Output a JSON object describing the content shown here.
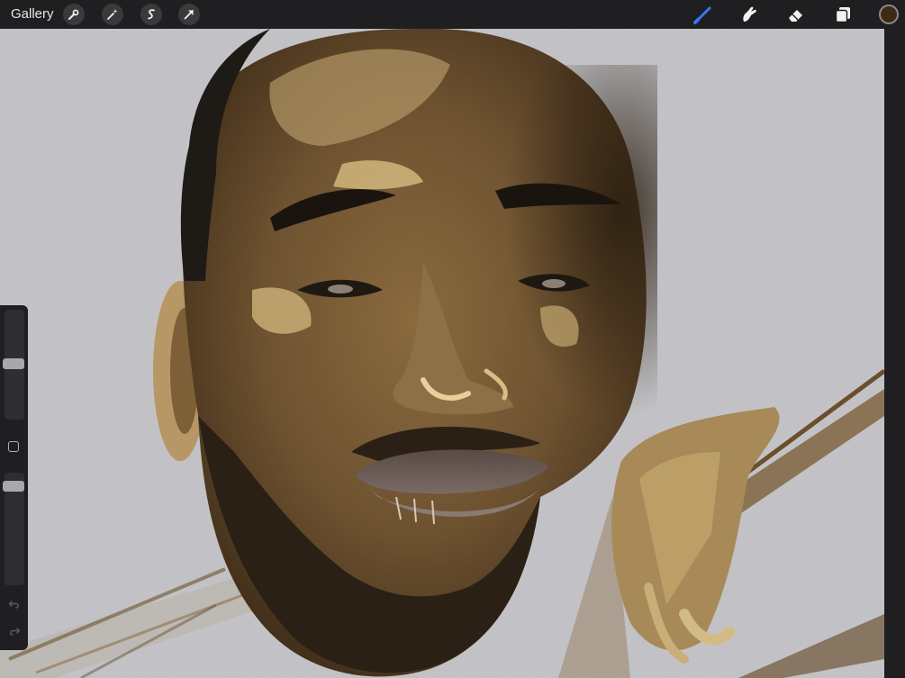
{
  "toolbar": {
    "gallery_label": "Gallery",
    "left_tools": [
      {
        "name": "actions",
        "icon": "wrench-icon"
      },
      {
        "name": "adjustments",
        "icon": "magic-wand-icon"
      },
      {
        "name": "selection",
        "icon": "lasso-s-icon"
      },
      {
        "name": "transform",
        "icon": "arrow-cursor-icon"
      }
    ],
    "right_tools": [
      {
        "name": "brush",
        "icon": "brush-icon",
        "active": true
      },
      {
        "name": "smudge",
        "icon": "smudge-finger-icon"
      },
      {
        "name": "eraser",
        "icon": "eraser-icon"
      },
      {
        "name": "layers",
        "icon": "layers-icon"
      }
    ],
    "active_color": "#3d2a12",
    "accent_color": "#3478f6"
  },
  "sidebar": {
    "brush_size": 0.51,
    "opacity": 0.92
  }
}
